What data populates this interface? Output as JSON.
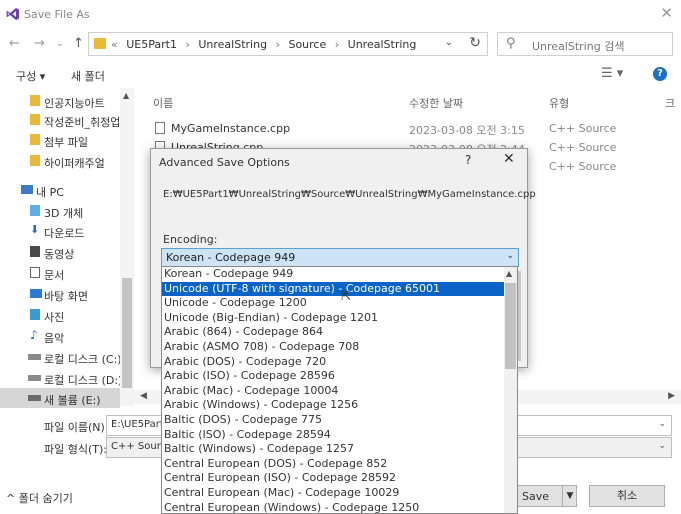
{
  "window": {
    "title": "Save File As"
  },
  "address": {
    "crumbs": [
      "UE5Part1",
      "UnrealString",
      "Source",
      "UnrealString"
    ],
    "search_placeholder": "UnrealString 검색"
  },
  "toolbar": {
    "organize": "구성 ▾",
    "new_folder": "새 폴더"
  },
  "sidebar": {
    "items": [
      {
        "label": "인공지능아트",
        "icon": "folder-icon"
      },
      {
        "label": "작성준비_취정업",
        "icon": "folder-icon"
      },
      {
        "label": "첨부 파일",
        "icon": "folder-icon"
      },
      {
        "label": "하이퍼캐주얼",
        "icon": "folder-icon"
      },
      {
        "label": "내 PC",
        "icon": "computer-icon"
      },
      {
        "label": "3D 개체",
        "icon": "cube-icon"
      },
      {
        "label": "다운로드",
        "icon": "download-icon"
      },
      {
        "label": "동영상",
        "icon": "video-icon"
      },
      {
        "label": "문서",
        "icon": "document-icon"
      },
      {
        "label": "바탕 화면",
        "icon": "desktop-icon"
      },
      {
        "label": "사진",
        "icon": "picture-icon"
      },
      {
        "label": "음악",
        "icon": "music-icon"
      },
      {
        "label": "로컬 디스크 (C:)",
        "icon": "drive-icon"
      },
      {
        "label": "로컬 디스크 (D:)",
        "icon": "drive-icon"
      },
      {
        "label": "새 볼륨 (E:)",
        "icon": "drive-icon"
      }
    ]
  },
  "filelist": {
    "headers": {
      "name": "이름",
      "date": "수정한 날짜",
      "type": "유형",
      "size": "크"
    },
    "rows": [
      {
        "name": "MyGameInstance.cpp",
        "date": "2023-03-08 오전 3:15",
        "type": "C++ Source"
      },
      {
        "name": "UnrealString.cpp",
        "date": "2023-03-08 오전 2:44",
        "type": "C++ Source"
      },
      {
        "name": "",
        "date": "",
        "type": "C++ Source"
      }
    ]
  },
  "form": {
    "filename_label": "파일 이름(N):",
    "filename_value": "E:\\UE5Part1",
    "filetype_label": "파일 형식(T):",
    "filetype_value": "C++ Source"
  },
  "bottom": {
    "hide_folders": "^ 폴더 숨기기",
    "save": "Save",
    "cancel": "취소"
  },
  "advanced": {
    "title": "Advanced Save Options",
    "help": "?",
    "path": "E:₩UE5Part1₩UnrealString₩Source₩UnrealString₩MyGameInstance.cpp",
    "encoding_label": "Encoding:",
    "encoding_selected": "Korean - Codepage 949",
    "options": [
      "Korean - Codepage 949",
      "Unicode (UTF-8 with signature) - Codepage 65001",
      "Unicode - Codepage 1200",
      "Unicode (Big-Endian) - Codepage 1201",
      "Arabic (864) - Codepage 864",
      "Arabic (ASMO 708) - Codepage 708",
      "Arabic (DOS) - Codepage 720",
      "Arabic (ISO) - Codepage 28596",
      "Arabic (Mac) - Codepage 10004",
      "Arabic (Windows) - Codepage 1256",
      "Baltic (DOS) - Codepage 775",
      "Baltic (ISO) - Codepage 28594",
      "Baltic (Windows) - Codepage 1257",
      "Central European (DOS) - Codepage 852",
      "Central European (ISO) - Codepage 28592",
      "Central European (Mac) - Codepage 10029",
      "Central European (Windows) - Codepage 1250"
    ],
    "highlighted_index": 1
  },
  "colors": {
    "accent": "#0a64c8",
    "help_blue": "#1a6fc9",
    "folder": "#e8b93a"
  }
}
